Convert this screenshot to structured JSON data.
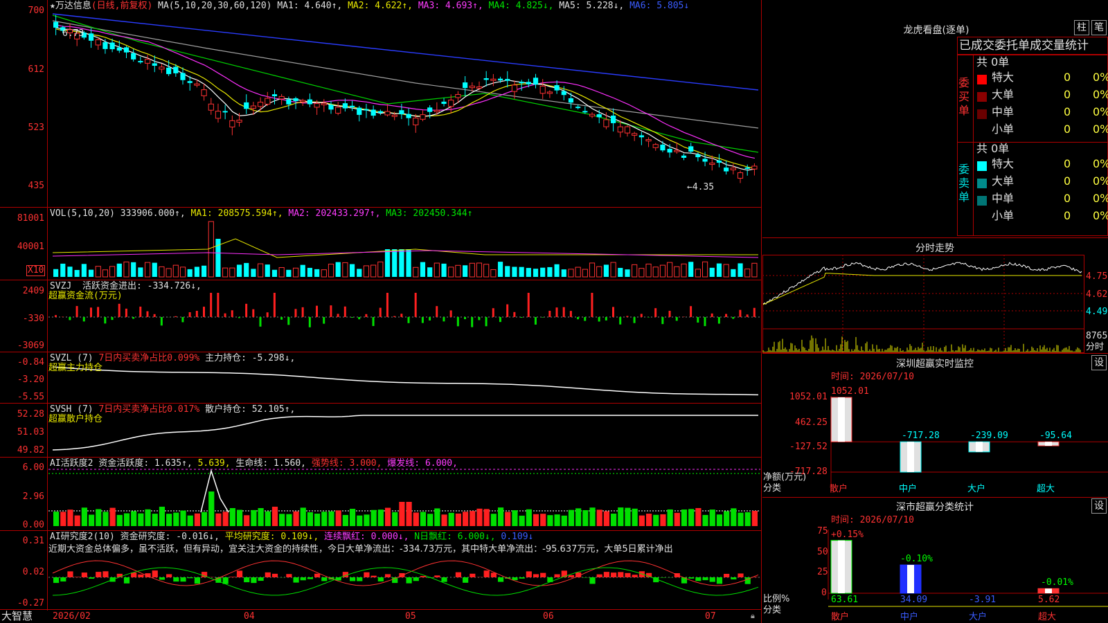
{
  "app_name": "大智慧",
  "main": {
    "stock_name": "★万达信息",
    "period": "(日线,前复权)",
    "ma_label": "MA(5,10,20,30,60,120)",
    "ma1": "MA1: 4.640↑,",
    "ma2": "MA2: 4.622↑,",
    "ma3": "MA3: 4.693↑,",
    "ma4": "MA4: 4.825↓,",
    "ma5": "MA5: 5.228↓,",
    "ma6": "MA6: 5.805↓",
    "axis": [
      "700",
      "612",
      "523",
      "435"
    ],
    "high_mark": "6.73",
    "low_mark": "←4.35"
  },
  "vol": {
    "label": "VOL(5,10,20)",
    "value": "333906.000↑,",
    "ma1": "MA1: 208575.594↑,",
    "ma2": "MA2: 202433.297↑,",
    "ma3": "MA3: 202450.344↑",
    "axis": [
      "81001",
      "40001"
    ],
    "unit": "X10"
  },
  "svzj": {
    "label": "SVZJ",
    "metric": "活跃资金进出: -334.726↓,",
    "sub": "超赢资金流(万元)",
    "axis": [
      "2409",
      "-330",
      "-3069"
    ]
  },
  "svzl": {
    "label": "SVZL (7)",
    "metric1": "7日内买卖净占比0.099%",
    "metric2": "主力持仓: -5.298↓,",
    "sub": "超赢主力持仓",
    "axis": [
      "-0.84",
      "-3.20",
      "-5.55"
    ]
  },
  "svsh": {
    "label": "SVSH (7)",
    "metric1": "7日内买卖净占比0.017%",
    "metric2": "散户持仓: 52.105↑,",
    "sub": "超赢散户持仓",
    "axis": [
      "52.28",
      "51.03",
      "49.82"
    ]
  },
  "ai1": {
    "label": "AI活跃度2",
    "m1": "资金活跃度: 1.635↑,",
    "m2": "5.639,",
    "m3": "生命线: 1.560,",
    "m4": "强势线: 3.000,",
    "m5": "爆发线: 6.000,",
    "axis": [
      "6.00",
      "2.96",
      "0.00"
    ]
  },
  "ai2": {
    "label": "AI研究度2(10)",
    "m1": "资金研究度: -0.016↓,",
    "m2": "平均研究度: 0.109↓,",
    "m3": "连续飘红: 0.000↓,",
    "m4": "N日飘红: 6.000↓,",
    "m5": "0.109↓",
    "comment": "近期大资金总体偏多，虽不活跃，但有异动，宜关注大资金的持续性，今日大单净流出：-334.73万元，其中特大单净流出：-95.637万元，大单5日累计净出",
    "axis": [
      "0.31",
      "0.02",
      "-0.27"
    ]
  },
  "xaxis": [
    "2026/02",
    "04",
    "05",
    "06",
    "07"
  ],
  "lhb": {
    "title": "龙虎看盘(逐单)",
    "btn1": "柱",
    "btn2": "笔",
    "subtitle": "已成交委托单成交量统计",
    "buy_label": "委买单",
    "sell_label": "委卖单",
    "buy_total": "共 0单",
    "sell_total": "共 0单",
    "buy_rows": [
      {
        "name": "特大",
        "count": "0",
        "pct": "0%",
        "color": "#ff0000"
      },
      {
        "name": "大单",
        "count": "0",
        "pct": "0%",
        "color": "#8b0000"
      },
      {
        "name": "中单",
        "count": "0",
        "pct": "0%",
        "color": "#6a0000"
      },
      {
        "name": "小单",
        "count": "0",
        "pct": "0%",
        "color": "#000000"
      }
    ],
    "sell_rows": [
      {
        "name": "特大",
        "count": "0",
        "pct": "0%",
        "color": "#00ffff"
      },
      {
        "name": "大单",
        "count": "0",
        "pct": "0%",
        "color": "#008b8b"
      },
      {
        "name": "中单",
        "count": "0",
        "pct": "0%",
        "color": "#007575"
      },
      {
        "name": "小单",
        "count": "0",
        "pct": "0%",
        "color": "#000000"
      }
    ]
  },
  "intraday": {
    "title": "分时走势",
    "axis": [
      "4.750",
      "4.620",
      "4.490"
    ],
    "vol_value": "8765",
    "vol_label": "分时"
  },
  "monitor": {
    "title": "深圳超赢实时监控",
    "btn": "设",
    "time": "时间: 2026/07/10",
    "axis": [
      "1052.01",
      "462.25",
      "-127.52",
      "-717.28"
    ],
    "ylabel1": "净额(万元)",
    "ylabel2": "分类",
    "bars": [
      {
        "cat": "散户",
        "value": 1052.01,
        "label": "1052.01"
      },
      {
        "cat": "中户",
        "value": -717.28,
        "label": "-717.28"
      },
      {
        "cat": "大户",
        "value": -239.09,
        "label": "-239.09"
      },
      {
        "cat": "超大",
        "value": -95.64,
        "label": "-95.64"
      }
    ]
  },
  "stats": {
    "title": "深市超赢分类统计",
    "btn": "设",
    "time": "时间: 2026/07/10",
    "axis": [
      "75",
      "50",
      "25",
      "0"
    ],
    "ylabel1": "比例%",
    "ylabel2": "分类",
    "bars": [
      {
        "cat": "散户",
        "pct": 63.61,
        "change": "+0.15%",
        "value": "63.61"
      },
      {
        "cat": "中户",
        "pct": 34.09,
        "change": "-0.10%",
        "value": "34.09"
      },
      {
        "cat": "大户",
        "pct": -3.91,
        "change": "",
        "value": "-3.91"
      },
      {
        "cat": "超大",
        "pct": 5.62,
        "change": "-0.01%",
        "value": "5.62"
      }
    ]
  }
}
